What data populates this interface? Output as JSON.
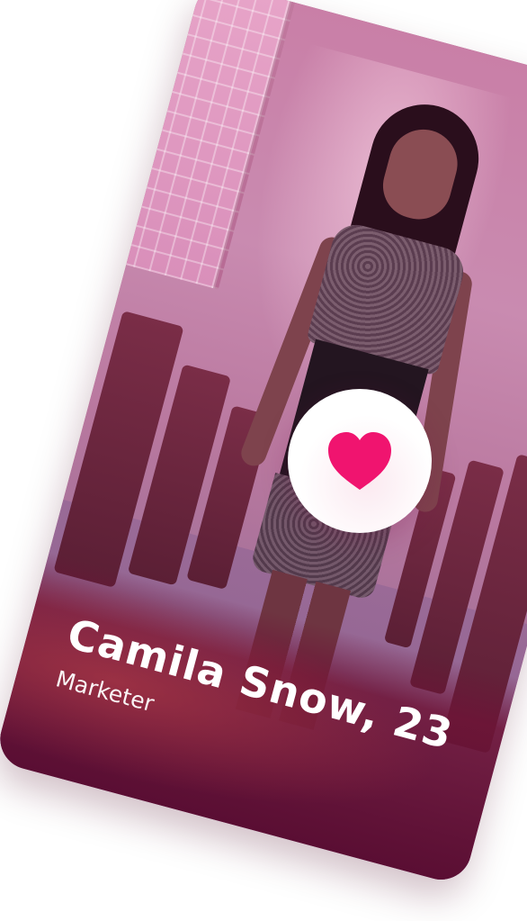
{
  "profile": {
    "name_age": "Camila Snow, 23",
    "occupation": "Marketer"
  },
  "like_button": {
    "icon": "heart-icon"
  },
  "colors": {
    "overlay": "#b45a86",
    "name_band": "#5a0e33",
    "heart": "#f0146f",
    "like_circle": "#ffffff"
  }
}
